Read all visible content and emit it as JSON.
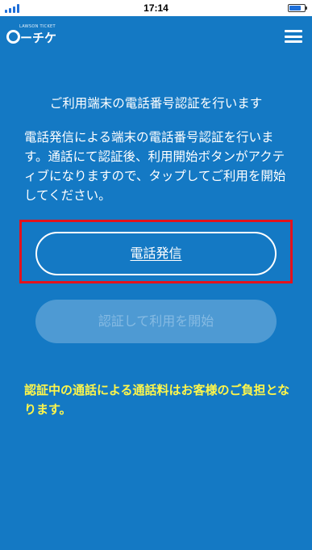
{
  "status_bar": {
    "time": "17:14"
  },
  "header": {
    "logo_tagline": "LAWSON TICKET",
    "logo_text": "ーチケ",
    "menu_icon": "hamburger-menu-icon"
  },
  "main": {
    "title": "ご利用端末の電話番号認証を行います",
    "description": "電話発信による端末の電話番号認証を行います。通話にて認証後、利用開始ボタンがアクティブになりますので、タップしてご利用を開始してください。",
    "call_button_label": "電話発信",
    "start_button_label": "認証して利用を開始",
    "notice": "認証中の通話による通話料はお客様のご負担となります。"
  },
  "colors": {
    "background": "#1479c4",
    "highlight": "#e4121c",
    "notice": "#fff64a",
    "disabled_button": "#4e9ad3"
  }
}
